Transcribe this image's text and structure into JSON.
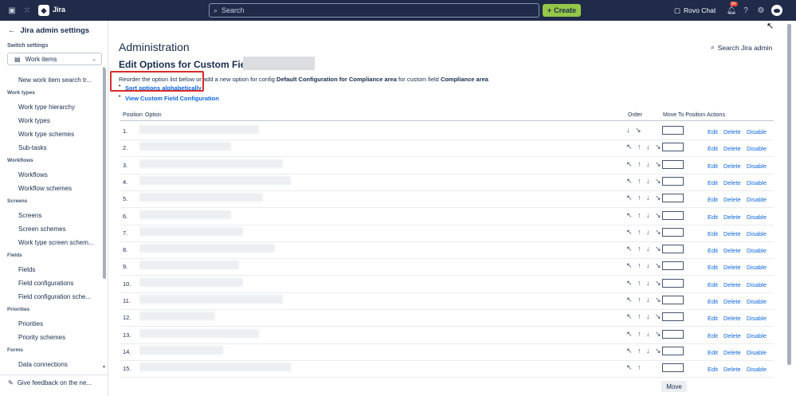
{
  "topbar": {
    "app_name": "Jira",
    "search_placeholder": "Search",
    "create_label": "Create",
    "rovo_label": "Rovo Chat",
    "notif_badge": "9+"
  },
  "sidebar": {
    "back_title": "Jira admin settings",
    "switch_label": "Switch settings",
    "switch_value": "Work items",
    "items": [
      {
        "type": "item",
        "label": "New work item search tr..."
      },
      {
        "type": "head",
        "label": "Work types"
      },
      {
        "type": "item",
        "label": "Work type hierarchy"
      },
      {
        "type": "item",
        "label": "Work types"
      },
      {
        "type": "item",
        "label": "Work type schemes"
      },
      {
        "type": "item",
        "label": "Sub-tasks"
      },
      {
        "type": "head",
        "label": "Workflows"
      },
      {
        "type": "item",
        "label": "Workflows"
      },
      {
        "type": "item",
        "label": "Workflow schemes"
      },
      {
        "type": "head",
        "label": "Screens"
      },
      {
        "type": "item",
        "label": "Screens"
      },
      {
        "type": "item",
        "label": "Screen schemes"
      },
      {
        "type": "item",
        "label": "Work type screen schem..."
      },
      {
        "type": "head",
        "label": "Fields"
      },
      {
        "type": "item",
        "label": "Fields"
      },
      {
        "type": "item",
        "label": "Field configurations"
      },
      {
        "type": "item",
        "label": "Field configuration sche..."
      },
      {
        "type": "head",
        "label": "Priorities"
      },
      {
        "type": "item",
        "label": "Priorities"
      },
      {
        "type": "item",
        "label": "Priority schemes"
      },
      {
        "type": "head",
        "label": "Forms"
      },
      {
        "type": "item",
        "label": "Data connections"
      }
    ],
    "feedback_label": "Give feedback on the ne..."
  },
  "main": {
    "admin_title": "Administration",
    "search_admin": "Search Jira admin",
    "edit_title": "Edit Options for Custom Field :",
    "reorder_prefix": "Reorder the option list below or add a new option for config ",
    "config_name": "Default Configuration for Compliance area",
    "reorder_middle": " for custom field ",
    "field_name": "Compliance area",
    "sort_link": "Sort options alphabetically",
    "view_link": "View Custom Field Configuration",
    "headers": {
      "position": "Position",
      "option": "Option",
      "order": "Order",
      "move_to": "Move To Position",
      "actions": "Actions"
    },
    "actions": {
      "edit": "Edit",
      "delete": "Delete",
      "disable": "Disable"
    },
    "rows": [
      {
        "pos": "1.",
        "order": "↓ ↘"
      },
      {
        "pos": "2.",
        "order": "↖ ↑ ↓ ↘"
      },
      {
        "pos": "3.",
        "order": "↖ ↑ ↓ ↘"
      },
      {
        "pos": "4.",
        "order": "↖ ↑ ↓ ↘"
      },
      {
        "pos": "5.",
        "order": "↖ ↑ ↓ ↘"
      },
      {
        "pos": "6.",
        "order": "↖ ↑ ↓ ↘"
      },
      {
        "pos": "7.",
        "order": "↖ ↑ ↓ ↘"
      },
      {
        "pos": "8.",
        "order": "↖ ↑ ↓ ↘"
      },
      {
        "pos": "9.",
        "order": "↖ ↑ ↓ ↘"
      },
      {
        "pos": "10.",
        "order": "↖ ↑ ↓ ↘"
      },
      {
        "pos": "11.",
        "order": "↖ ↑ ↓ ↘"
      },
      {
        "pos": "12.",
        "order": "↖ ↑ ↓ ↘"
      },
      {
        "pos": "13.",
        "order": "↖ ↑ ↓ ↘"
      },
      {
        "pos": "14.",
        "order": "↖ ↑ ↓ ↘"
      },
      {
        "pos": "15.",
        "order": "↖ ↑"
      }
    ],
    "move_button": "Move"
  }
}
